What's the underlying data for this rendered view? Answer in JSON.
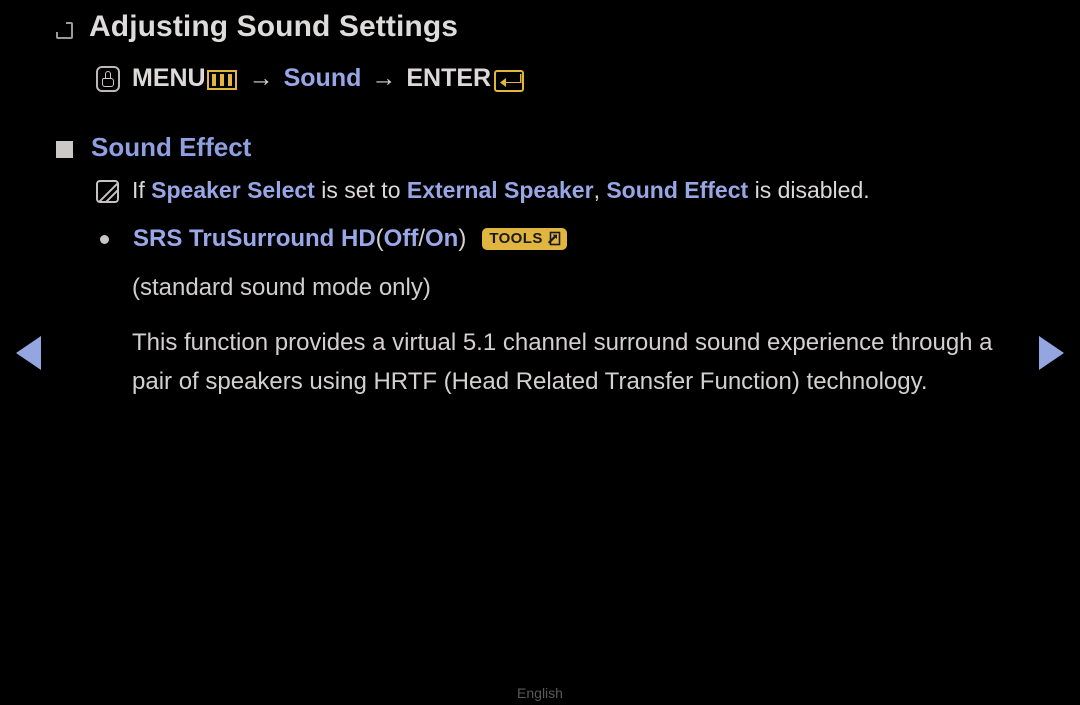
{
  "page": {
    "title": "Adjusting Sound Settings",
    "title_bullet_icon": "hollow-square-icon"
  },
  "menu_path": {
    "hand_icon": "hand-pointer-icon",
    "menu_label": "MENU",
    "menu_icon": "menu-bars-icon",
    "separator_1": "→",
    "target_label": "Sound",
    "separator_2": "→",
    "enter_label": "ENTER",
    "enter_icon": "enter-return-icon"
  },
  "section": {
    "bullet_icon": "filled-square-icon",
    "title": "Sound Effect"
  },
  "note": {
    "icon": "note-pencil-icon",
    "prefix": "If ",
    "term_1": "Speaker Select",
    "middle_1": " is set to ",
    "term_2": "External Speaker",
    "comma": ", ",
    "term_3": "Sound Effect",
    "suffix": " is disabled."
  },
  "option": {
    "bullet_icon": "dot-bullet-icon",
    "label": "SRS TruSurround HD",
    "paren_open": " (",
    "value_off": "Off",
    "value_divider": " / ",
    "value_on": "On",
    "paren_close": ")",
    "badge_label": "TOOLS",
    "badge_icon": "tools-arrow-icon"
  },
  "sub_note": "(standard sound mode only)",
  "body_paragraph": "This function provides a virtual 5.1 channel surround sound experience through a pair of speakers using HRTF (Head Related Transfer Function) technology.",
  "navigation": {
    "prev_icon": "triangle-left-icon",
    "next_icon": "triangle-right-icon"
  },
  "footer": {
    "language": "English"
  },
  "colors": {
    "background": "#000000",
    "body_text": "#d4d0d0",
    "accent_blue": "#9aa8e8",
    "accent_gold": "#e0b641",
    "nav_arrow": "#93a6e0",
    "footer_text": "#5b5858"
  }
}
